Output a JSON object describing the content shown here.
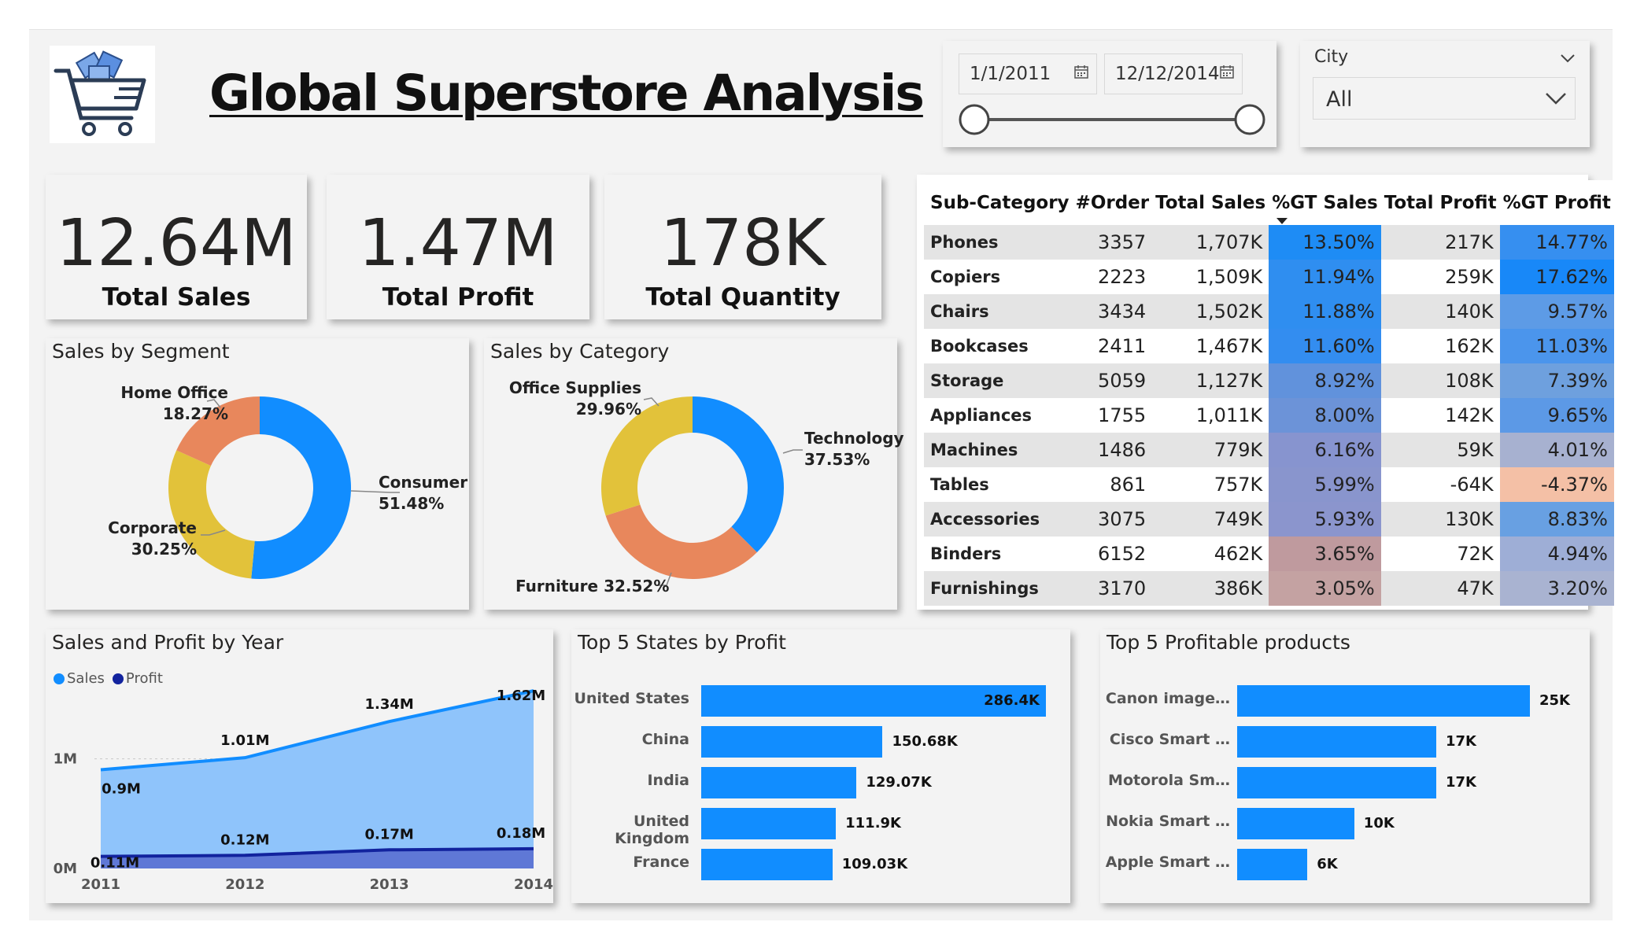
{
  "header": {
    "title": "Global Superstore Analysis",
    "logo_icon": "shopping-cart-icon"
  },
  "date_filter": {
    "start": "1/1/2011",
    "end": "12/12/2014"
  },
  "city_filter": {
    "label": "City",
    "value": "All"
  },
  "kpis": {
    "sales": {
      "value": "12.64M",
      "label": "Total Sales"
    },
    "profit": {
      "value": "1.47M",
      "label": "Total Profit"
    },
    "quantity": {
      "value": "178K",
      "label": "Total Quantity"
    }
  },
  "segment": {
    "title": "Sales by Segment",
    "labels": [
      {
        "name": "Home Office",
        "pct": "18.27%"
      },
      {
        "name": "Consumer",
        "pct": "51.48%"
      },
      {
        "name": "Corporate",
        "pct": "30.25%"
      }
    ]
  },
  "category": {
    "title": "Sales by Category",
    "labels": [
      {
        "name": "Office Supplies",
        "pct": "29.96%"
      },
      {
        "name": "Technology",
        "pct": "37.53%"
      },
      {
        "name": "Furniture",
        "pct": "32.52%"
      }
    ]
  },
  "table": {
    "headers": [
      "Sub-Category",
      "#Order",
      "Total Sales",
      "%GT Sales",
      "Total Profit",
      "%GT Profit"
    ],
    "rows": [
      {
        "sub": "Phones",
        "orders": "3357",
        "sales": "1,707K",
        "gt_sales": "13.50%",
        "profit": "217K",
        "gt_profit": "14.77%"
      },
      {
        "sub": "Copiers",
        "orders": "2223",
        "sales": "1,509K",
        "gt_sales": "11.94%",
        "profit": "259K",
        "gt_profit": "17.62%"
      },
      {
        "sub": "Chairs",
        "orders": "3434",
        "sales": "1,502K",
        "gt_sales": "11.88%",
        "profit": "140K",
        "gt_profit": "9.57%"
      },
      {
        "sub": "Bookcases",
        "orders": "2411",
        "sales": "1,467K",
        "gt_sales": "11.60%",
        "profit": "162K",
        "gt_profit": "11.03%"
      },
      {
        "sub": "Storage",
        "orders": "5059",
        "sales": "1,127K",
        "gt_sales": "8.92%",
        "profit": "108K",
        "gt_profit": "7.39%"
      },
      {
        "sub": "Appliances",
        "orders": "1755",
        "sales": "1,011K",
        "gt_sales": "8.00%",
        "profit": "142K",
        "gt_profit": "9.65%"
      },
      {
        "sub": "Machines",
        "orders": "1486",
        "sales": "779K",
        "gt_sales": "6.16%",
        "profit": "59K",
        "gt_profit": "4.01%"
      },
      {
        "sub": "Tables",
        "orders": "861",
        "sales": "757K",
        "gt_sales": "5.99%",
        "profit": "-64K",
        "gt_profit": "-4.37%"
      },
      {
        "sub": "Accessories",
        "orders": "3075",
        "sales": "749K",
        "gt_sales": "5.93%",
        "profit": "130K",
        "gt_profit": "8.83%"
      },
      {
        "sub": "Binders",
        "orders": "6152",
        "sales": "462K",
        "gt_sales": "3.65%",
        "profit": "72K",
        "gt_profit": "4.94%"
      },
      {
        "sub": "Furnishings",
        "orders": "3170",
        "sales": "386K",
        "gt_sales": "3.05%",
        "profit": "47K",
        "gt_profit": "3.20%"
      }
    ],
    "colors": {
      "gt_sales": [
        "#1e8cf5",
        "#2f8ef0",
        "#2f8ef0",
        "#338df0",
        "#6192dc",
        "#6c93d8",
        "#8794cf",
        "#8995cd",
        "#8b95cd",
        "#bf9a9e",
        "#c4a2a2"
      ],
      "gt_profit": [
        "#368ff0",
        "#1888f8",
        "#5d9be6",
        "#4b95ec",
        "#6ea0de",
        "#5c99e6",
        "#a7b1d0",
        "#f4c0a6",
        "#68a0e2",
        "#9eaed6",
        "#a9b3d1"
      ]
    }
  },
  "year_chart": {
    "title": "Sales and Profit by Year",
    "legend": [
      {
        "name": "Sales",
        "color": "#118dff"
      },
      {
        "name": "Profit",
        "color": "#12239e"
      }
    ]
  },
  "states": {
    "title": "Top 5 States by Profit",
    "names": [
      "United States",
      "China",
      "India",
      "United Kingdom",
      "France"
    ],
    "values": [
      286.4,
      150.68,
      129.07,
      111.9,
      109.03
    ],
    "labels": [
      "286.4K",
      "150.68K",
      "129.07K",
      "111.9K",
      "109.03K"
    ]
  },
  "products": {
    "title": "Top 5 Profitable products",
    "names": [
      "Canon image…",
      "Cisco Smart …",
      "Motorola Sm…",
      "Nokia Smart …",
      "Apple Smart …"
    ],
    "values": [
      25,
      17,
      17,
      10,
      6
    ],
    "labels": [
      "25K",
      "17K",
      "17K",
      "10K",
      "6K"
    ]
  },
  "chart_data": [
    {
      "type": "pie",
      "title": "Sales by Segment",
      "categories": [
        "Consumer",
        "Corporate",
        "Home Office"
      ],
      "values": [
        51.48,
        30.25,
        18.27
      ],
      "colors": [
        "#118dff",
        "#e2c23a",
        "#e8875c"
      ]
    },
    {
      "type": "pie",
      "title": "Sales by Category",
      "categories": [
        "Technology",
        "Furniture",
        "Office Supplies"
      ],
      "values": [
        37.53,
        32.52,
        29.96
      ],
      "colors": [
        "#118dff",
        "#e8875c",
        "#e2c23a"
      ]
    },
    {
      "type": "area",
      "title": "Sales and Profit by Year",
      "x": [
        "2011",
        "2012",
        "2013",
        "2014"
      ],
      "series": [
        {
          "name": "Sales",
          "values": [
            0.9,
            1.01,
            1.34,
            1.62
          ],
          "labels": [
            "0.9M",
            "1.01M",
            "1.34M",
            "1.62M"
          ]
        },
        {
          "name": "Profit",
          "values": [
            0.11,
            0.12,
            0.17,
            0.18
          ],
          "labels": [
            "0.11M",
            "0.12M",
            "0.17M",
            "0.18M"
          ]
        }
      ],
      "y_ticks": [
        "0M",
        "1M"
      ],
      "ylim": [
        0,
        1.75
      ]
    },
    {
      "type": "bar",
      "title": "Top 5 States by Profit",
      "categories": [
        "United States",
        "China",
        "India",
        "United Kingdom",
        "France"
      ],
      "values": [
        286.4,
        150.68,
        129.07,
        111.9,
        109.03
      ]
    },
    {
      "type": "bar",
      "title": "Top 5 Profitable products",
      "categories": [
        "Canon image…",
        "Cisco Smart …",
        "Motorola Sm…",
        "Nokia Smart …",
        "Apple Smart …"
      ],
      "values": [
        25,
        17,
        17,
        10,
        6
      ]
    }
  ]
}
